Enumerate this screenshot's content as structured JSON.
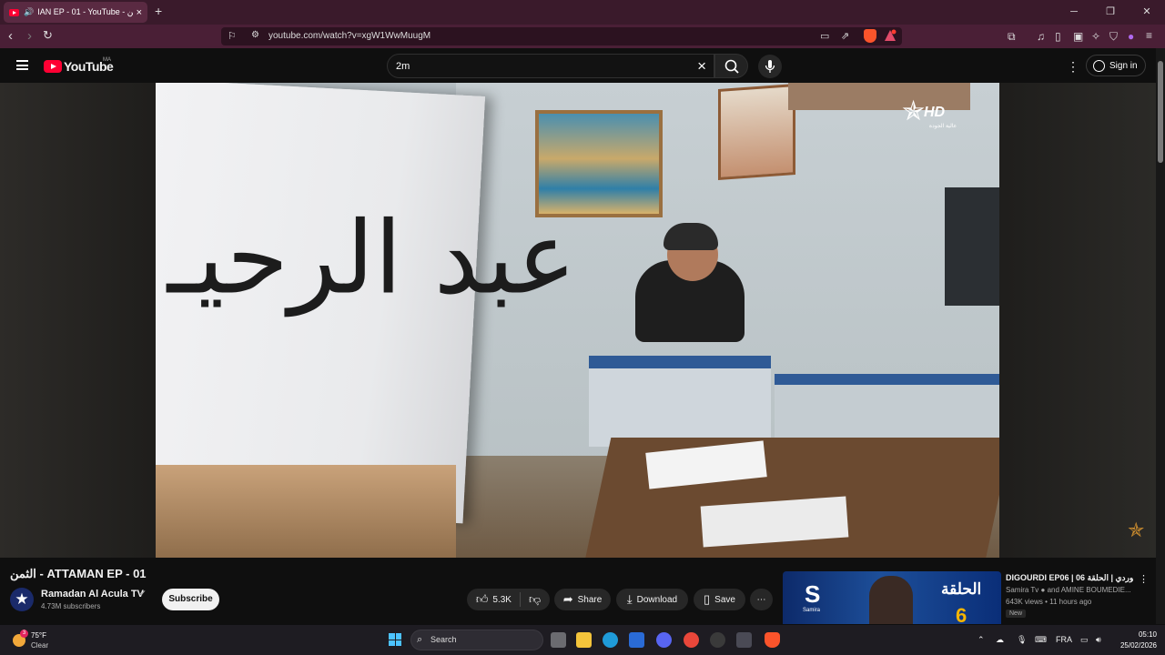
{
  "browser": {
    "tab_title": "IAN EP - 01 - YouTube - الثمن",
    "url": "youtube.com/watch?v=xgW1WwMuugM",
    "new_tab_label": "+"
  },
  "youtube": {
    "logo_text": "YouTube",
    "country_code": "MA",
    "search_value": "2m",
    "signin_label": "Sign in"
  },
  "video": {
    "sign_text": "عبد الرحيـ",
    "channel_logo_text": "HD",
    "channel_logo_sub": "عالية الجودة",
    "title": "الثمن - ATTAMAN EP - 01",
    "channel_name": "Ramadan Al Acula TV",
    "subscribers": "4.73M subscribers",
    "subscribe_label": "Subscribe",
    "likes": "5.3K",
    "share_label": "Share",
    "download_label": "Download",
    "save_label": "Save"
  },
  "recommendation": {
    "thumb_logo": "S",
    "thumb_logo_label": "Samira",
    "thumb_arabic": "الحلقة",
    "thumb_number": "6",
    "title": "DIGOURDI EP06 | ديغوردي | الحلقة 06",
    "channel": "Samira Tv ● and AMINE BOUMEDIE...",
    "meta": "643K views • 11 hours ago",
    "badge": "New"
  },
  "taskbar": {
    "temperature": "75°F",
    "condition": "Clear",
    "weather_badge": "3",
    "search_label": "Search",
    "language": "FRA",
    "time": "05:10",
    "date": "25/02/2026"
  },
  "colors": {
    "youtube_red": "#ff0033",
    "browser_tab_bg": "#3a1a2b",
    "youtube_bg": "#0f0f0f"
  }
}
